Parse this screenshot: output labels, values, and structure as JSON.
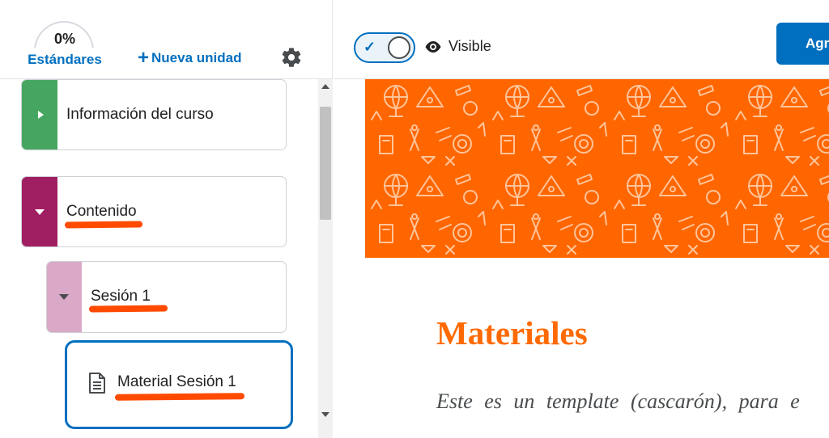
{
  "colors": {
    "accent_blue": "#006fbf",
    "brand_orange": "#ff6600",
    "highlight_orange": "#ff4a00",
    "module_green": "#46a661",
    "module_magenta": "#a01f62",
    "module_pink": "#d9a9c7"
  },
  "header": {
    "standards_percent": "0%",
    "standards_label": "Estándares",
    "new_unit_label": "Nueva unidad",
    "new_unit_icon": "plus-icon",
    "settings_icon": "gear-icon"
  },
  "tree": {
    "items": [
      {
        "label": "Información del curso",
        "icon": "chevron-right-icon"
      },
      {
        "label": "Contenido",
        "icon": "chevron-down-icon"
      },
      {
        "label": "Sesión 1",
        "icon": "chevron-down-icon"
      },
      {
        "label": "Material Sesión 1",
        "icon": "document-icon"
      }
    ]
  },
  "toolbar": {
    "visibility_label": "Visible",
    "visibility_icon": "eye-icon",
    "toggle_icon": "check-icon",
    "add_button_label": "Agr"
  },
  "content": {
    "title": "Materiales",
    "body_text": "Este es un template (cascarón), para e"
  }
}
